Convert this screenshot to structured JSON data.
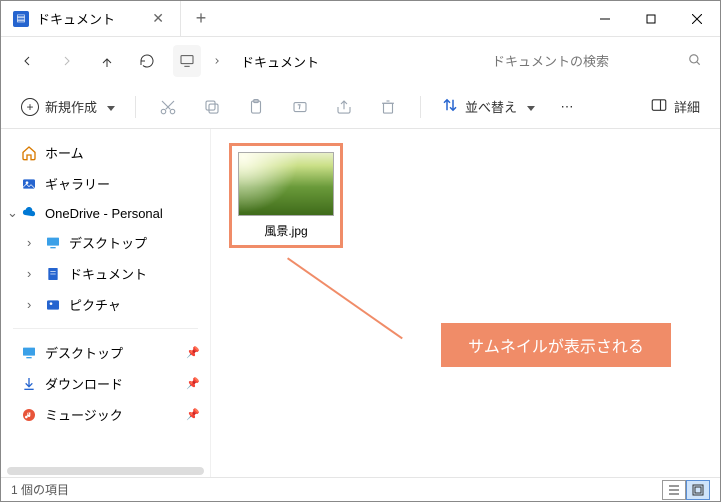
{
  "tab": {
    "title": "ドキュメント"
  },
  "breadcrumb": {
    "current": "ドキュメント"
  },
  "search": {
    "placeholder": "ドキュメントの検索"
  },
  "toolbar": {
    "new_label": "新規作成",
    "sort_label": "並べ替え",
    "details_label": "詳細"
  },
  "sidebar": {
    "home": "ホーム",
    "gallery": "ギャラリー",
    "onedrive": "OneDrive - Personal",
    "od_desktop": "デスクトップ",
    "od_documents": "ドキュメント",
    "od_pictures": "ピクチャ",
    "quick_desktop": "デスクトップ",
    "quick_downloads": "ダウンロード",
    "quick_music": "ミュージック"
  },
  "file": {
    "name": "風景.jpg"
  },
  "annotation": {
    "text": "サムネイルが表示される"
  },
  "status": {
    "text": "1 個の項目"
  }
}
